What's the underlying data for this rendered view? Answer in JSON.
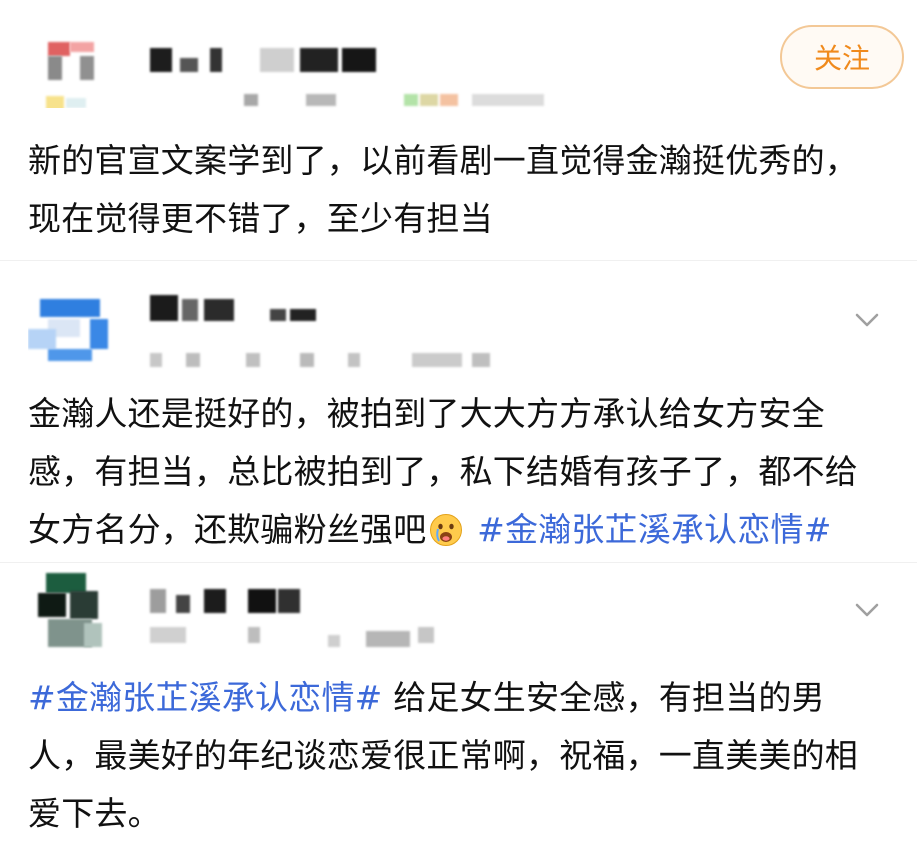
{
  "post1": {
    "follow_label": "关注",
    "text": "新的官宣文案学到了，以前看剧一直觉得金瀚挺优秀的，现在觉得更不错了，至少有担当"
  },
  "post2": {
    "text_part1": "金瀚人还是挺好的，被拍到了大大方方承认给女方安全感，有担当，总比被拍到了，私下结婚有孩子了，都不给女方名分，还欺骗粉丝强吧",
    "hashtag": "#金瀚张芷溪承认恋情#"
  },
  "post3": {
    "hashtag": "#金瀚张芷溪承认恋情#",
    "text": " 给足女生安全感，有担当的男人，最美好的年纪谈恋爱很正常啊，祝福，一直美美的相爱下去。"
  },
  "icons": {
    "chevron": "chevron-down-icon",
    "emoji": "crying-face-emoji"
  },
  "colors": {
    "hashtag": "#3c69d9",
    "follow_text": "#f08a1c",
    "follow_border": "#f3c896"
  }
}
